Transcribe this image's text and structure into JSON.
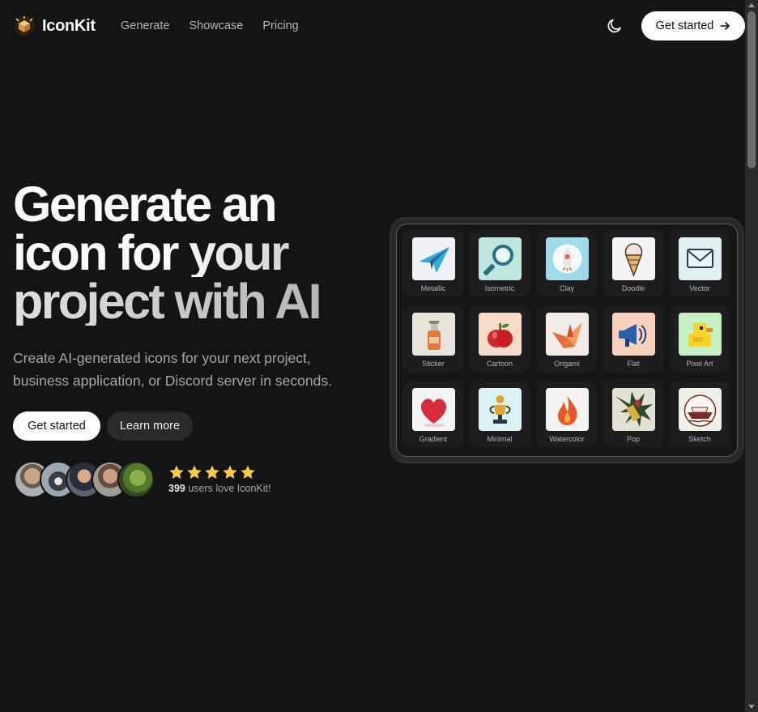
{
  "nav": {
    "brand": "IconKit",
    "links": [
      "Generate",
      "Showcase",
      "Pricing"
    ],
    "cta_label": "Get started",
    "icons": {
      "logo": "box-logo-icon",
      "theme": "moon-icon",
      "cta_arrow": "arrow-right-icon"
    }
  },
  "hero": {
    "title_line1": "Generate an",
    "title_line2": "icon for your",
    "title_line3": "project with AI",
    "subtitle": "Create AI-generated icons for your next project, business application, or Discord server in seconds.",
    "primary_button": "Get started",
    "secondary_button": "Learn more",
    "rating": {
      "stars": 5,
      "count": "399",
      "text": " users love IconKit!"
    }
  },
  "showcase": {
    "styles": [
      {
        "label": "Metallic",
        "icon": "paper-plane-icon",
        "bg": "#eef2f6"
      },
      {
        "label": "Isometric",
        "icon": "magnifier-icon",
        "bg": "#bfe6df"
      },
      {
        "label": "Clay",
        "icon": "rocket-icon",
        "bg": "#9fdaea"
      },
      {
        "label": "Doodle",
        "icon": "ice-cream-icon",
        "bg": "#f4f4f2"
      },
      {
        "label": "Vector",
        "icon": "envelope-icon",
        "bg": "#dff0f4"
      },
      {
        "label": "Sticker",
        "icon": "spray-bottle-icon",
        "bg": "#e9e4dc"
      },
      {
        "label": "Cartoon",
        "icon": "apple-icon",
        "bg": "#f6dcc8"
      },
      {
        "label": "Origami",
        "icon": "paper-crane-icon",
        "bg": "#f3ece6"
      },
      {
        "label": "Flat",
        "icon": "megaphone-icon",
        "bg": "#f6d1bd"
      },
      {
        "label": "Pixel Art",
        "icon": "duck-icon",
        "bg": "#c4f0c4"
      },
      {
        "label": "Gradient",
        "icon": "heart-icon",
        "bg": "#f4f4f6"
      },
      {
        "label": "Minimal",
        "icon": "trophy-icon",
        "bg": "#dcf3f6"
      },
      {
        "label": "Watercolor",
        "icon": "flame-icon",
        "bg": "#f3f2f0"
      },
      {
        "label": "Pop",
        "icon": "lipstick-icon",
        "bg": "#e4e0d4"
      },
      {
        "label": "Sketch",
        "icon": "boat-icon",
        "bg": "#f2eee8"
      }
    ]
  },
  "colors": {
    "background": "#141416",
    "star": "#f7c948",
    "accent": "#ffffff"
  }
}
